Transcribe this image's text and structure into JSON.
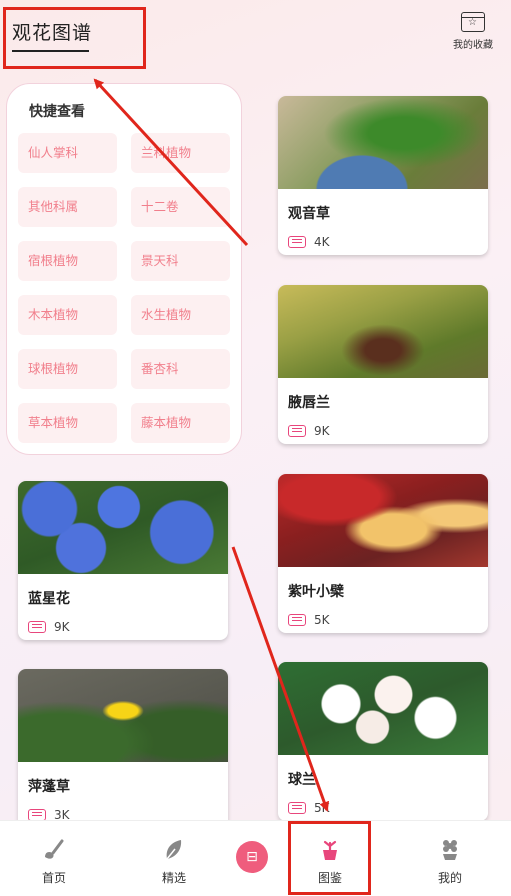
{
  "header": {
    "title": "观花图谱",
    "favorites_label": "我的收藏",
    "favorites_icon": "star-box-icon"
  },
  "quick_view": {
    "title": "快捷查看",
    "tags": [
      "仙人掌科",
      "兰科植物",
      "其他科属",
      "十二卷",
      "宿根植物",
      "景天科",
      "木本植物",
      "水生植物",
      "球根植物",
      "番杏科",
      "草本植物",
      "藤本植物"
    ]
  },
  "cards": [
    {
      "name": "观音草",
      "count": "4K",
      "icon": "doc-icon"
    },
    {
      "name": "腋唇兰",
      "count": "9K",
      "icon": "doc-icon"
    },
    {
      "name": "蓝星花",
      "count": "9K",
      "icon": "doc-icon"
    },
    {
      "name": "紫叶小檗",
      "count": "5K",
      "icon": "doc-icon"
    },
    {
      "name": "萍蓬草",
      "count": "3K",
      "icon": "doc-icon"
    },
    {
      "name": "球兰",
      "count": "5K",
      "icon": "doc-icon"
    }
  ],
  "tabbar": {
    "items": [
      {
        "label": "首页",
        "icon": "brush-icon"
      },
      {
        "label": "精选",
        "icon": "leaf-icon"
      },
      {
        "label": "图鉴",
        "icon": "flower-pot-icon"
      },
      {
        "label": "我的",
        "icon": "flower-profile-icon"
      }
    ],
    "center_icon": "scan-icon",
    "center_glyph": "⊟"
  },
  "colors": {
    "accent": "#e8467c",
    "annotation": "#e0261c",
    "tag_text": "#f17f8c",
    "tag_bg": "#fdf0f1"
  }
}
